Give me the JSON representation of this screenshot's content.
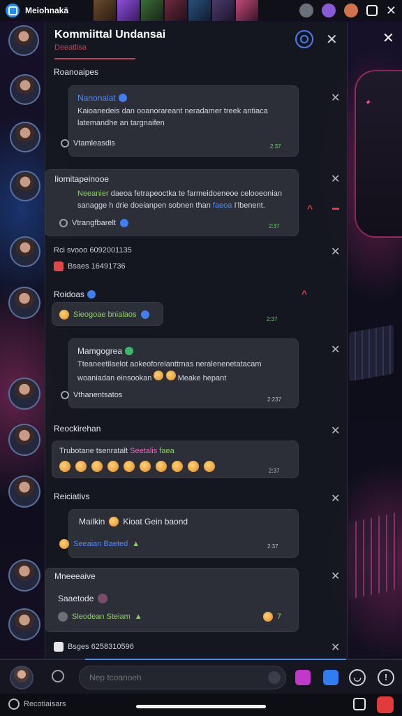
{
  "app": {
    "name": "Meiohnakä"
  },
  "header": {
    "title": "Kommiittal Undansai",
    "subtitle": "Deeatlisa"
  },
  "sections": {
    "s1": "Roanoaipes",
    "s2": "Iiomitapeinooe",
    "s3_line1": "Rci svooo  6092001135",
    "s3_line2": "Bsaes  16491736",
    "s4": "Roidoas",
    "s5": "Reockirehan",
    "s6": "Reiciativs",
    "s7": "Mneeeaive",
    "s8_line": "Bsges  6258310596"
  },
  "cards": {
    "c1": {
      "title": "Nanonalat",
      "body": "Kaioanedeis dan ooanorareant neradamer treek antiaca latemandhe an targnaifen",
      "author": "Vtamleasdis",
      "time": "2:37"
    },
    "c2": {
      "body_pre": "Neeanier",
      "body_mid": " daeoa fetrapeoctka te farmeidoeneoe celooeonian sanagge ",
      "body_mid2": " h drie doeianpen sobnen than ",
      "body_blue": "faeoa",
      "body_post": " I'lbenent.",
      "author": "Vtrangfbarelt",
      "time": "2:37"
    },
    "c3": {
      "label": "Sieogoae bnialaos"
    },
    "c4": {
      "title": "Mamgogrea",
      "body": "Tteaneetilaelot aokeoforelanttrnas neralenenetatacam woaniadan einsookan",
      "body_tail": "Meake hepant",
      "author": "Vthanentsatos",
      "time": "2:237"
    },
    "c5": {
      "label_pre": "Trubotane tsenratalt ",
      "label_pink": "Seetalis",
      "label_post": " faea"
    },
    "c6": {
      "title_pre": "Mailkin",
      "title_post": "Kioat Gein baond",
      "sub": "Seeaian Baeted",
      "time": "2:37"
    },
    "c7": {
      "title": "Saaetode",
      "sub": "Sleodean Steiam",
      "count": "7"
    }
  },
  "composer": {
    "placeholder": "Nep tcoanoeh"
  },
  "navbar": {
    "status": "Recotiaisars"
  },
  "colors": {
    "accent": "#4c8df6",
    "danger": "#e53b3b",
    "pink": "#c0455a",
    "online": "#8fd066"
  },
  "icons": [
    "app-icon",
    "search-icon",
    "close-icon",
    "badge-icon",
    "heart-icon",
    "mic-icon",
    "video-icon",
    "info-icon"
  ]
}
